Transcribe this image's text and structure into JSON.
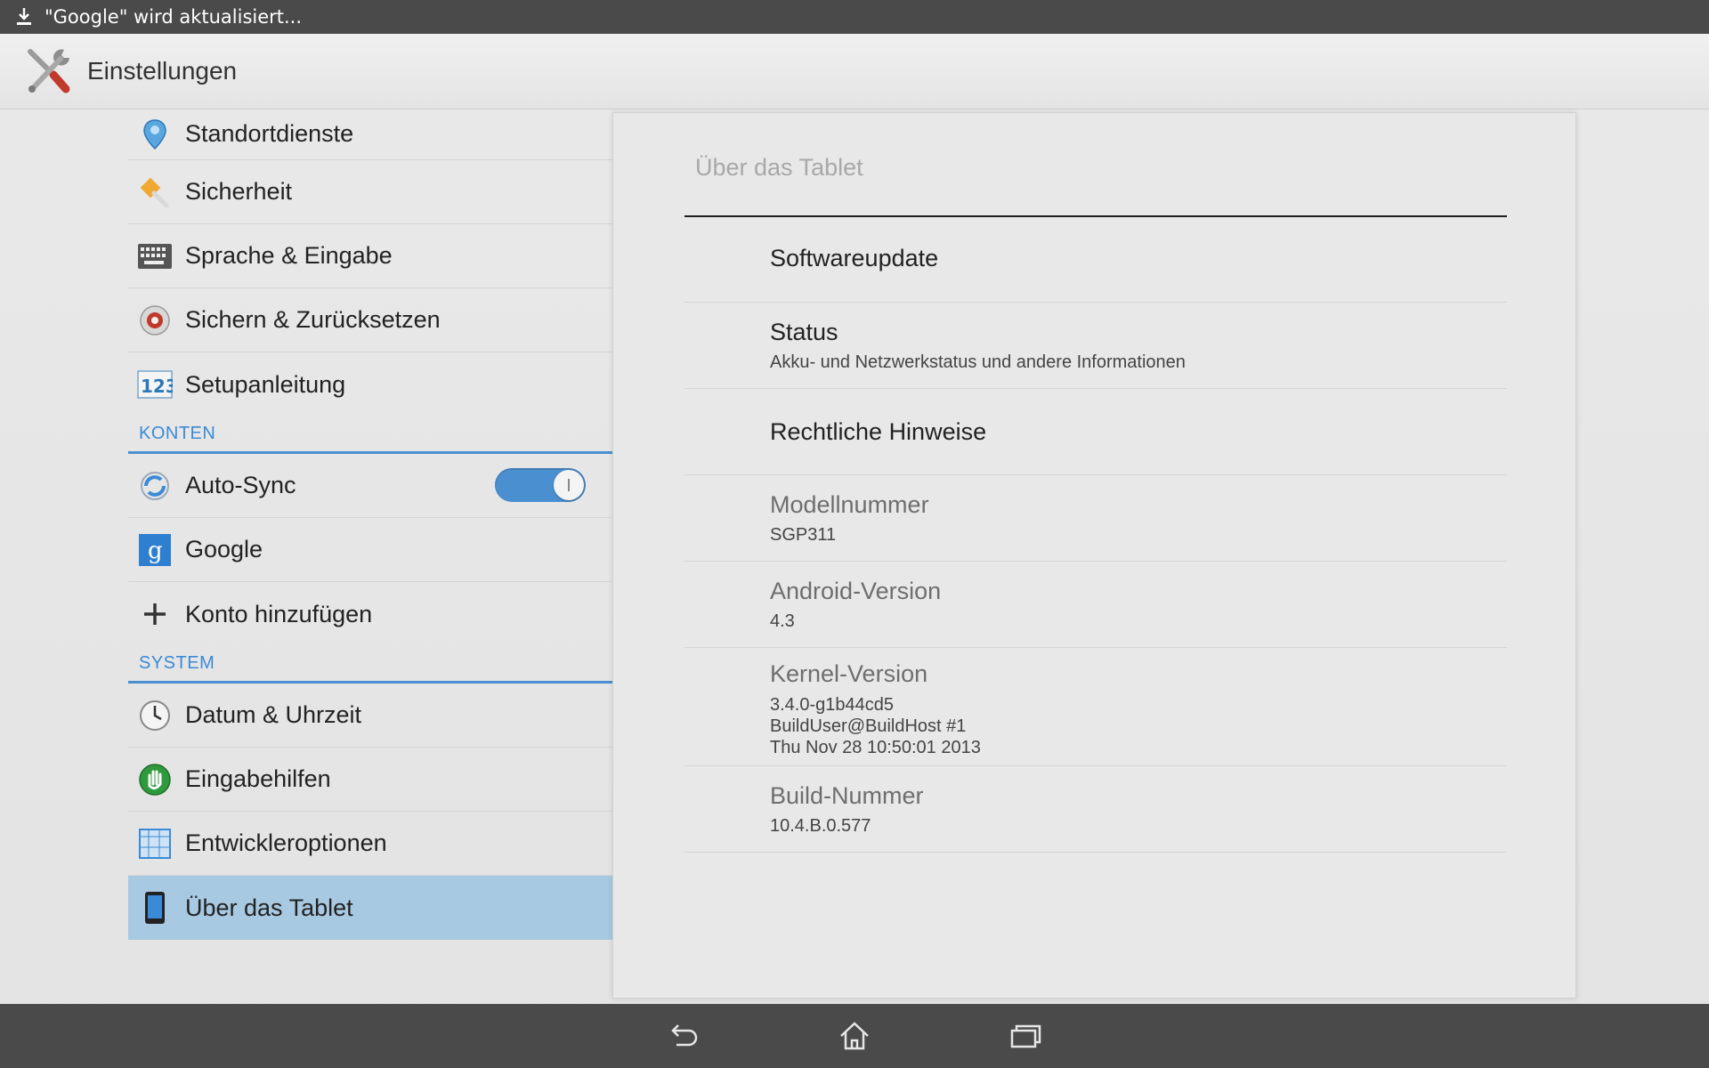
{
  "status_bar": {
    "notification_icon": "download-icon",
    "notification_text": "\"Google\" wird aktualisiert..."
  },
  "action_bar": {
    "app_icon": "settings-tools-icon",
    "title": "Einstellungen"
  },
  "left_list": {
    "items_top": [
      {
        "label": "Standortdienste",
        "icon": "location-icon"
      },
      {
        "label": "Sicherheit",
        "icon": "security-icon"
      },
      {
        "label": "Sprache & Eingabe",
        "icon": "keyboard-icon"
      },
      {
        "label": "Sichern & Zurücksetzen",
        "icon": "backup-icon"
      },
      {
        "label": "Setupanleitung",
        "icon": "setup-123-icon"
      }
    ],
    "section_accounts": "KONTEN",
    "items_accounts": [
      {
        "label": "Auto-Sync",
        "icon": "sync-icon",
        "toggle": true
      },
      {
        "label": "Google",
        "icon": "google-icon"
      },
      {
        "label": "Konto hinzufügen",
        "icon": "plus-icon"
      }
    ],
    "section_system": "SYSTEM",
    "items_system": [
      {
        "label": "Datum & Uhrzeit",
        "icon": "clock-icon"
      },
      {
        "label": "Eingabehilfen",
        "icon": "accessibility-hand-icon"
      },
      {
        "label": "Entwickleroptionen",
        "icon": "developer-icon"
      },
      {
        "label": "Über das Tablet",
        "icon": "tablet-icon",
        "selected": true
      }
    ]
  },
  "detail": {
    "title": "Über das Tablet",
    "rows": [
      {
        "title": "Softwareupdate"
      },
      {
        "title": "Status",
        "subtitle": "Akku- und Netzwerkstatus und andere Informationen"
      },
      {
        "title": "Rechtliche Hinweise"
      },
      {
        "title": "Modellnummer",
        "subtitle": "SGP311"
      },
      {
        "title": "Android-Version",
        "subtitle": "4.3"
      },
      {
        "title": "Kernel-Version",
        "subtitle_lines": [
          "3.4.0-g1b44cd5",
          "BuildUser@BuildHost #1",
          "Thu Nov 28 10:50:01 2013"
        ]
      },
      {
        "title": "Build-Nummer",
        "subtitle": "10.4.B.0.577"
      }
    ]
  },
  "nav_bar": {
    "buttons": [
      "back-icon",
      "home-icon",
      "recents-icon"
    ]
  },
  "colors": {
    "accent": "#4a90d0",
    "selected_row": "#a8c9e2",
    "system_bar": "#4a4a4a"
  }
}
